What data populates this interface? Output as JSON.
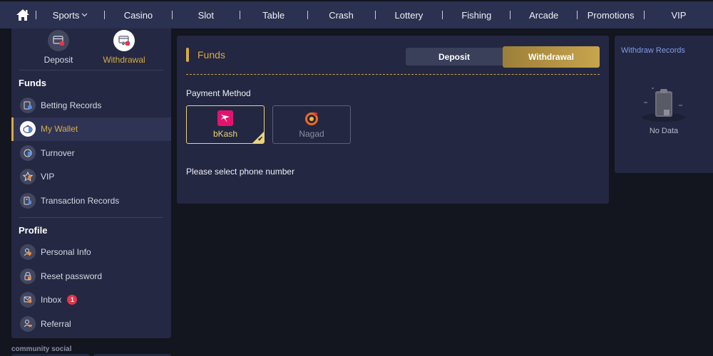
{
  "nav": {
    "items": [
      {
        "label": "Sports",
        "has_dropdown": true
      },
      {
        "label": "Casino"
      },
      {
        "label": "Slot"
      },
      {
        "label": "Table"
      },
      {
        "label": "Crash"
      },
      {
        "label": "Lottery"
      },
      {
        "label": "Fishing"
      },
      {
        "label": "Arcade"
      },
      {
        "label": "Promotions"
      },
      {
        "label": "VIP"
      }
    ],
    "home_icon": "home-icon",
    "dropdown_glyph": "⌄"
  },
  "sidebar": {
    "quick": [
      {
        "label": "Deposit",
        "icon": "deposit-card-icon",
        "active": false
      },
      {
        "label": "Withdrawal",
        "icon": "withdrawal-card-icon",
        "active": true
      }
    ],
    "funds_title": "Funds",
    "funds_items": [
      {
        "label": "Betting Records",
        "icon": "betting-records-icon"
      },
      {
        "label": "My Wallet",
        "icon": "wallet-icon",
        "active": true
      },
      {
        "label": "Turnover",
        "icon": "turnover-icon"
      },
      {
        "label": "VIP",
        "icon": "vip-star-icon"
      },
      {
        "label": "Transaction Records",
        "icon": "transaction-records-icon"
      }
    ],
    "profile_title": "Profile",
    "profile_items": [
      {
        "label": "Personal Info",
        "icon": "personal-info-icon"
      },
      {
        "label": "Reset password",
        "icon": "lock-icon"
      },
      {
        "label": "Inbox",
        "icon": "inbox-icon",
        "badge": "1"
      },
      {
        "label": "Referral",
        "icon": "referral-icon"
      }
    ],
    "community_label": "community social"
  },
  "main": {
    "title": "Funds",
    "tabs": [
      {
        "label": "Deposit",
        "active": false
      },
      {
        "label": "Withdrawal",
        "active": true
      }
    ],
    "payment_method_label": "Payment Method",
    "methods": [
      {
        "name": "bKash",
        "selected": true,
        "color": "#e2136e"
      },
      {
        "name": "Nagad",
        "selected": false,
        "color": "#f06a24"
      }
    ],
    "phone_label": "Please select phone number"
  },
  "records": {
    "title": "Withdraw Records",
    "empty_text": "No Data"
  },
  "colors": {
    "accent_gold": "#d4ab47",
    "nav_bg": "#2b3150",
    "panel_bg": "#232741",
    "link_blue": "#7f9ee8",
    "badge_red": "#e8344b"
  }
}
